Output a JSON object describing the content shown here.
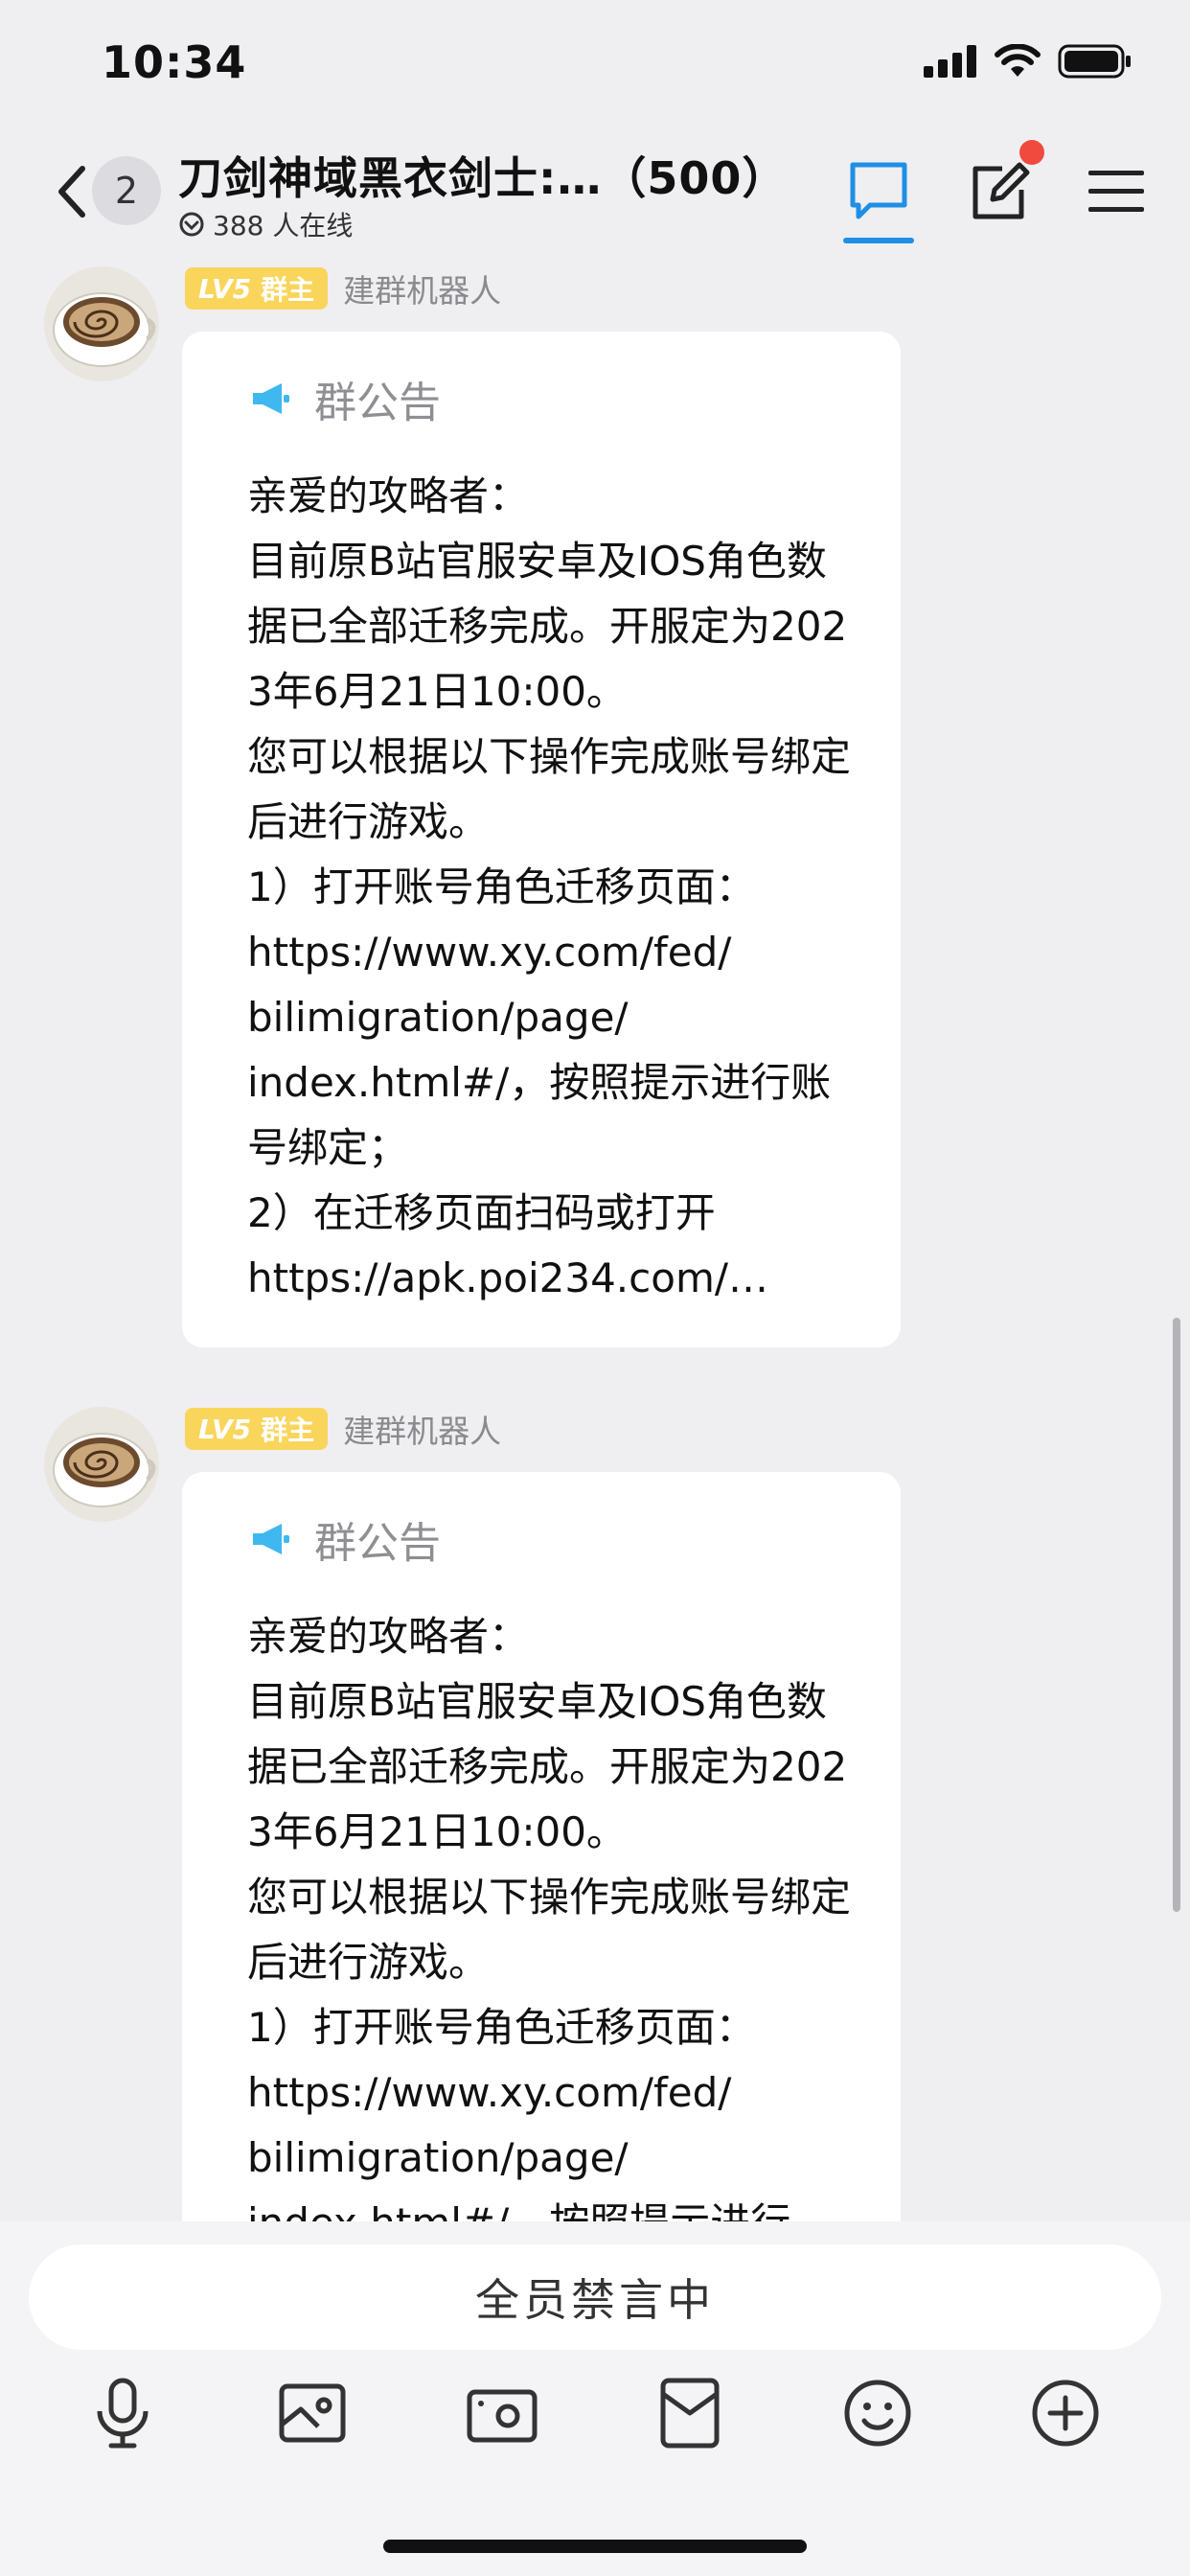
{
  "status_bar": {
    "time": "10:34"
  },
  "nav": {
    "unread_count": "2",
    "title": "刀剑神域黑衣剑士:…（500）",
    "online": "388 人在线"
  },
  "messages": [
    {
      "level": "LV5",
      "role": "群主",
      "sender": "建群机器人",
      "notice_title": "群公告",
      "body": "亲爱的攻略者：\n目前原B站官服安卓及IOS角色数据已全部迁移完成。开服定为2023年6月21日10:00。\n您可以根据以下操作完成账号绑定后进行游戏。\n1）打开账号角色迁移页面：\nhttps://www.xy.com/fed/\nbilimigration/page/\nindex.html#/，按照提示进行账号绑定；\n2）在迁移页面扫码或打开\nhttps://apk.poi234.com/…"
    },
    {
      "level": "LV5",
      "role": "群主",
      "sender": "建群机器人",
      "notice_title": "群公告",
      "body": "亲爱的攻略者：\n目前原B站官服安卓及IOS角色数据已全部迁移完成。开服定为2023年6月21日10:00。\n您可以根据以下操作完成账号绑定后进行游戏。\n1）打开账号角色迁移页面：\nhttps://www.xy.com/fed/\nbilimigration/page/\nindex.html#/，按照提示进行"
    }
  ],
  "input": {
    "muted_label": "全员禁言中"
  },
  "colors": {
    "accent": "#1f8fe6",
    "level_badge": "#f9d55c",
    "notify_dot": "#f04a3e",
    "megaphone": "#3fb8f0"
  },
  "icons": {
    "nav": [
      "back-chevron-icon",
      "chat-icon",
      "edit-icon",
      "menu-icon"
    ],
    "toolbar": [
      "microphone-icon",
      "image-icon",
      "camera-icon",
      "red-packet-icon",
      "emoji-icon",
      "plus-icon"
    ]
  }
}
